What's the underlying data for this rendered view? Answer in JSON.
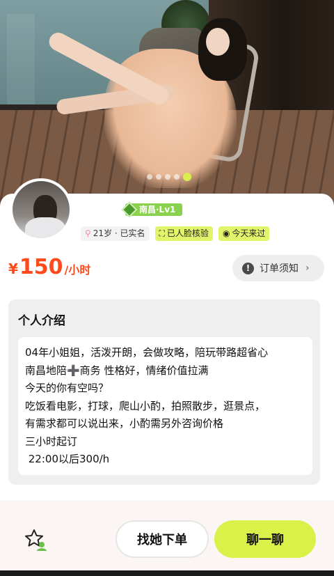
{
  "hero": {
    "photo_description_icon": "portrait-photo",
    "carousel": {
      "count": 5,
      "active_index": 4
    }
  },
  "profile": {
    "level_badge": "南昌·Lv1",
    "tags": [
      {
        "icon": "location-pin-icon",
        "text": "21岁 · 已实名"
      },
      {
        "icon": "face-scan-icon",
        "text": "已人脸核验"
      },
      {
        "icon": "record-dot-icon",
        "text": "今天来过"
      }
    ]
  },
  "price": {
    "currency": "¥",
    "amount": "150",
    "unit": "/小时"
  },
  "order_notice": {
    "label": "订单须知",
    "icon": "exclamation-icon",
    "chevron": "›"
  },
  "intro": {
    "title": "个人介绍",
    "lines": [
      "04年小姐姐，活泼开朗，会做攻略，陪玩带路超省心",
      "南昌地陪➕商务 性格好，情绪价值拉满",
      "今天的你有空吗？",
      "吃饭看电影，打球，爬山小酌，拍照散步，逛景点，",
      "有需求都可以说出来，小酌需另外咨询价格",
      "三小时起订",
      " 22:00以后300/h"
    ]
  },
  "actions": {
    "favorite_icon": "star-user-icon",
    "order_button": "找她下单",
    "chat_button": "聊一聊"
  },
  "colors": {
    "accent_green": "#daf14a",
    "price_red": "#ff4a1c",
    "level_green": "#8ad24e"
  }
}
